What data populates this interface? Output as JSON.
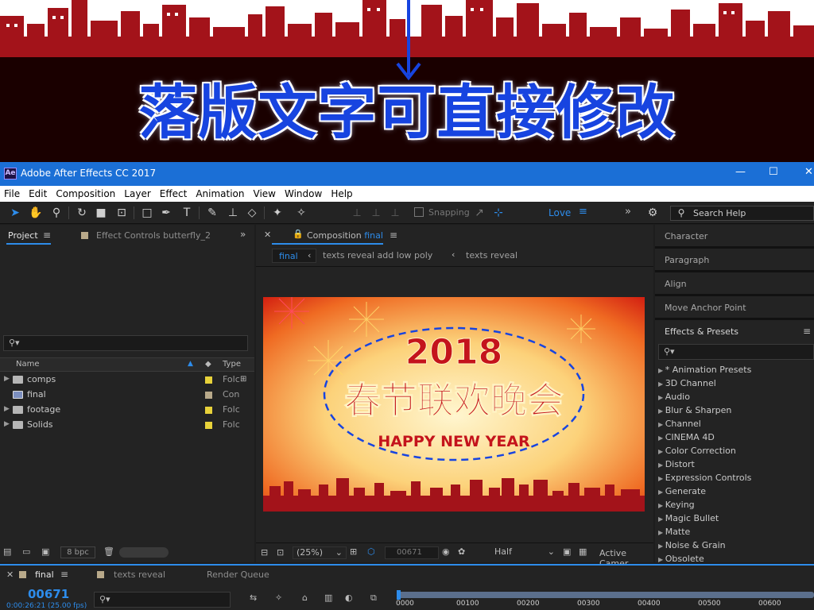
{
  "banner": {
    "caption": "落版文字可直接修改"
  },
  "window": {
    "title": "Adobe After Effects CC 2017",
    "logo": "Ae",
    "minimize": "—",
    "maximize": "☐",
    "close": "✕"
  },
  "menu": [
    "File",
    "Edit",
    "Composition",
    "Layer",
    "Effect",
    "Animation",
    "View",
    "Window",
    "Help"
  ],
  "toolbar": {
    "snapping": "Snapping",
    "workspace": "Love",
    "search_help": "Search Help",
    "icons": [
      "selection-tool-icon",
      "hand-tool-icon",
      "zoom-tool-icon",
      "rotate-tool-icon",
      "camera-tool-icon",
      "pan-behind-tool-icon",
      "rectangle-tool-icon",
      "pen-tool-icon",
      "type-tool-icon",
      "brush-tool-icon",
      "clone-stamp-tool-icon",
      "eraser-tool-icon",
      "roto-brush-tool-icon",
      "puppet-pin-tool-icon"
    ]
  },
  "project_panel": {
    "tab": "Project",
    "effect_controls_tab": "Effect Controls butterfly_2",
    "columns": {
      "name": "Name",
      "type": "Type"
    },
    "items": [
      {
        "name": "comps",
        "type": "Folc",
        "kind": "folder",
        "label_color": "#e8d23a"
      },
      {
        "name": "final",
        "type": "Con",
        "kind": "comp",
        "label_color": "#b8a98a"
      },
      {
        "name": "footage",
        "type": "Folc",
        "kind": "folder",
        "label_color": "#e8d23a"
      },
      {
        "name": "Solids",
        "type": "Folc",
        "kind": "folder",
        "label_color": "#e8d23a"
      }
    ],
    "bpc": "8 bpc"
  },
  "comp_panel": {
    "tab_prefix": "Composition",
    "tab_name": "final",
    "breadcrumbs": [
      "final",
      "texts reveal add low poly",
      "texts reveal"
    ],
    "frame": {
      "year": "2018",
      "title_cn": "春节联欢晚会",
      "subtitle": "HAPPY NEW YEAR"
    },
    "zoom": "(25%)",
    "timecode": "00671",
    "resolution": "Half",
    "camera": "Active Camer"
  },
  "right_panel": {
    "sections": [
      "Character",
      "Paragraph",
      "Align",
      "Move Anchor Point"
    ],
    "effects_title": "Effects & Presets",
    "effects": [
      "* Animation Presets",
      "3D Channel",
      "Audio",
      "Blur & Sharpen",
      "Channel",
      "CINEMA 4D",
      "Color Correction",
      "Distort",
      "Expression Controls",
      "Generate",
      "Keying",
      "Magic Bullet",
      "Matte",
      "Noise & Grain",
      "Obsolete"
    ]
  },
  "timeline": {
    "tabs": [
      "final",
      "texts reveal",
      "Render Queue"
    ],
    "current_frame": "00671",
    "current_time": "0:00:26:21 (25.00 fps)",
    "ruler": [
      "0000",
      "00100",
      "00200",
      "00300",
      "00400",
      "00500",
      "00600"
    ]
  },
  "colors": {
    "accent": "#2d8ceb",
    "titlebar": "#1b6fd6",
    "banner_red": "#a3131a",
    "caption_blue": "#1744e0"
  }
}
